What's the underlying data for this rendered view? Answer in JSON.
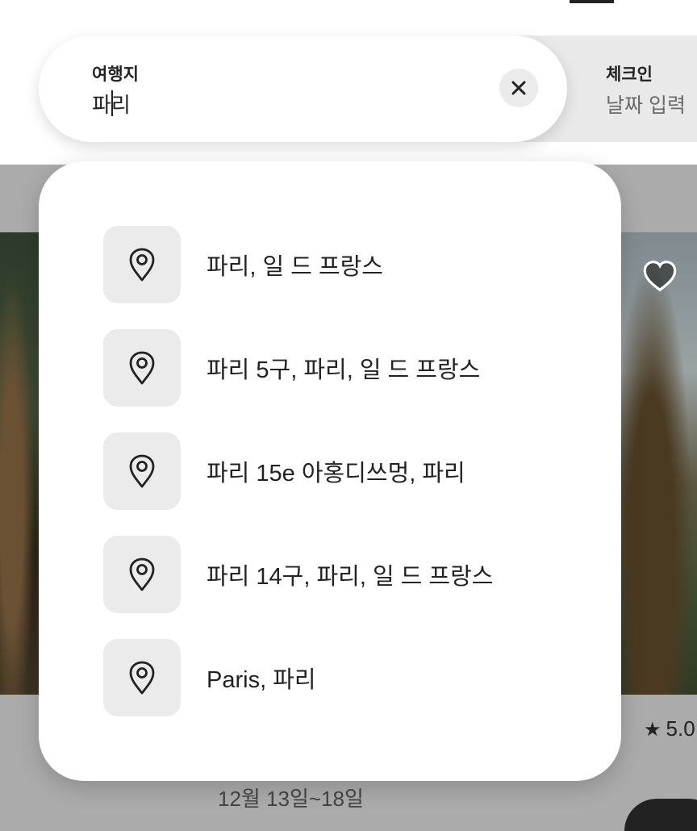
{
  "search": {
    "destination_label": "여행지",
    "destination_value": "파리",
    "checkin_label": "체크인",
    "checkin_placeholder": "날짜 입력"
  },
  "suggestions": [
    {
      "label": "파리, 일 드 프랑스",
      "icon": "location-pin-icon"
    },
    {
      "label": "파리 5구, 파리, 일 드 프랑스",
      "icon": "location-pin-icon"
    },
    {
      "label": "파리 15e 아홍디쓰멍, 파리",
      "icon": "location-pin-icon"
    },
    {
      "label": "파리 14구, 파리, 일 드 프랑스",
      "icon": "location-pin-icon"
    },
    {
      "label": "Paris, 파리",
      "icon": "location-pin-icon"
    }
  ],
  "background_listing": {
    "rating_value": "5.0",
    "dates": "12월 13일~18일"
  },
  "colors": {
    "overlay": "#ababab",
    "text": "#222222",
    "icon_tile": "#ebebeb"
  }
}
